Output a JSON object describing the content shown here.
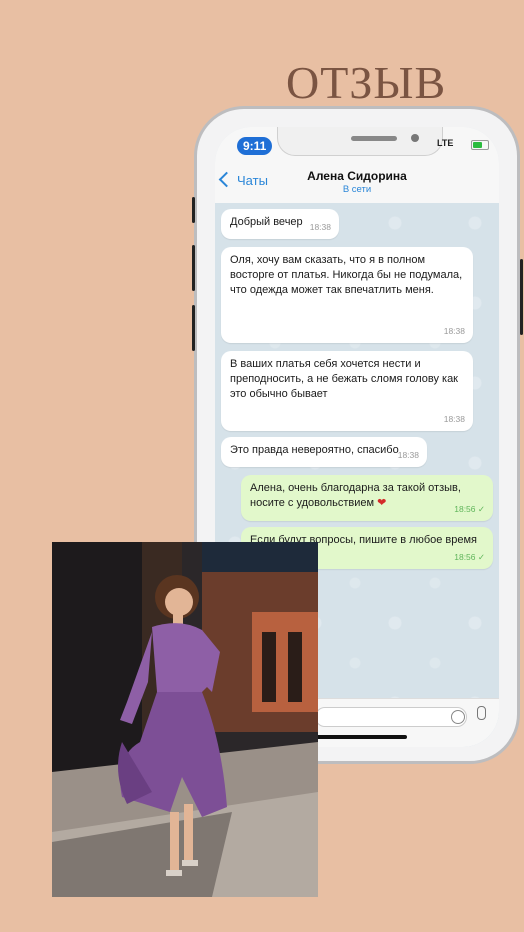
{
  "page": {
    "title": "ОТЗЫВ"
  },
  "status_bar": {
    "time": "9:11",
    "network": "LTE"
  },
  "chat_header": {
    "back_label": "Чаты",
    "name": "Алена Сидорина",
    "status": "В сети"
  },
  "messages": [
    {
      "direction": "in",
      "text": "Добрый вечер",
      "time": "18:38"
    },
    {
      "direction": "in",
      "text": "Оля, хочу вам сказать, что я в полном восторге от платья. Никогда бы не подумала, что одежда может так впечатлить меня.",
      "time": "18:38"
    },
    {
      "direction": "in",
      "text": "В ваших платья себя хочется нести и преподносить, а не бежать сломя голову как это обычно бывает",
      "time": "18:38"
    },
    {
      "direction": "in",
      "text": "Это правда невероятно, спасибо",
      "time": "18:38"
    },
    {
      "direction": "out",
      "text": "Алена, очень благодарна за такой отзыв, носите с удовольствием",
      "emoji": "❤",
      "time": "18:56 ✓"
    },
    {
      "direction": "out",
      "text": "Если будут вопросы, пишите в любое время",
      "time": "18:56 ✓"
    }
  ],
  "colors": {
    "background": "#e8bfa3",
    "title": "#7a5442",
    "accent": "#2a86d8",
    "outgoing_bubble": "#e2f8cb",
    "dress": "#8e5fa6"
  },
  "icons": {
    "back": "chevron-left-icon",
    "sticker": "sticker-icon",
    "mic": "microphone-icon"
  }
}
